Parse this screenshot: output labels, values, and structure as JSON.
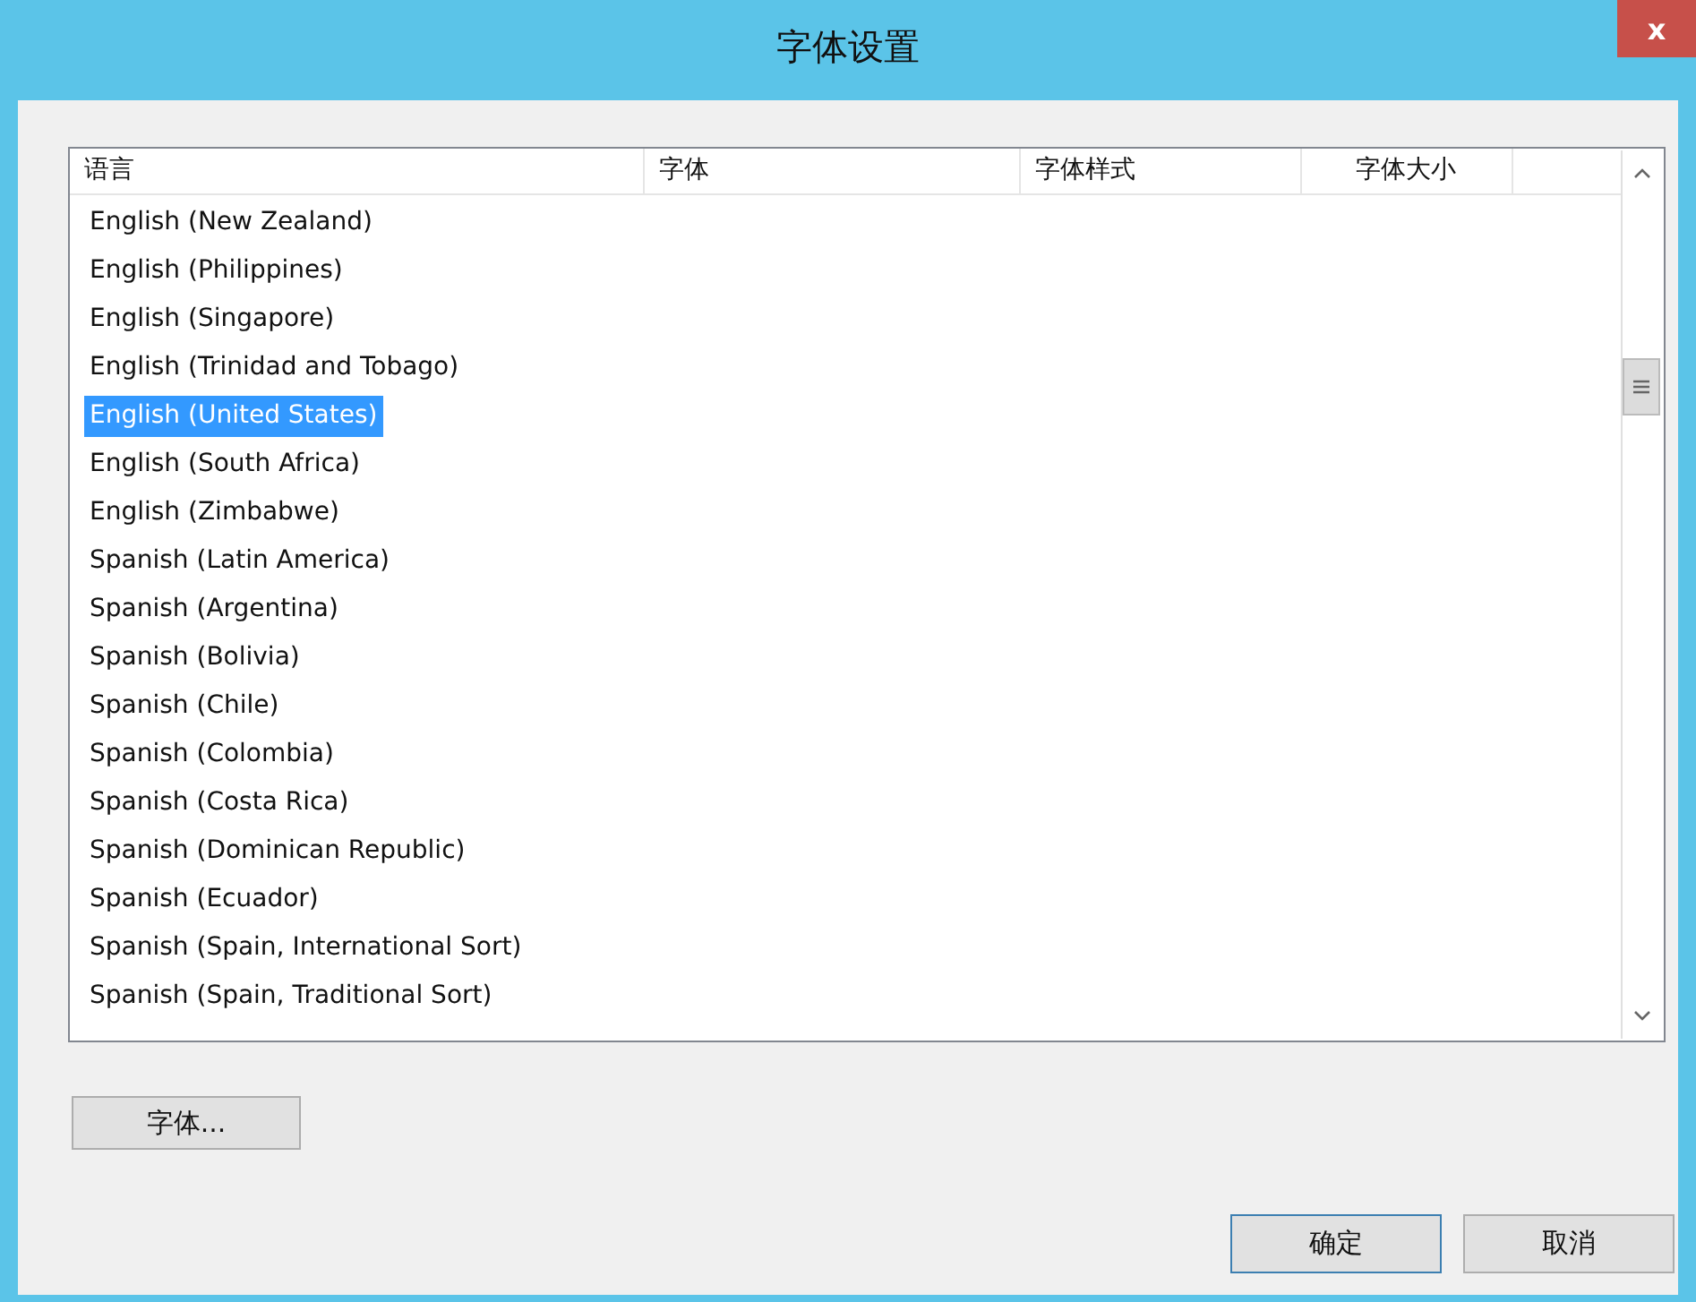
{
  "window": {
    "title": "字体设置",
    "close": "x"
  },
  "table": {
    "columns": [
      "语言",
      "字体",
      "字体样式",
      "字体大小"
    ],
    "rows": [
      {
        "language": "English (New Zealand)",
        "selected": false
      },
      {
        "language": "English (Philippines)",
        "selected": false
      },
      {
        "language": "English (Singapore)",
        "selected": false
      },
      {
        "language": "English (Trinidad and Tobago)",
        "selected": false
      },
      {
        "language": "English (United States)",
        "selected": true
      },
      {
        "language": "English (South Africa)",
        "selected": false
      },
      {
        "language": "English (Zimbabwe)",
        "selected": false
      },
      {
        "language": "Spanish (Latin America)",
        "selected": false
      },
      {
        "language": "Spanish (Argentina)",
        "selected": false
      },
      {
        "language": "Spanish (Bolivia)",
        "selected": false
      },
      {
        "language": "Spanish (Chile)",
        "selected": false
      },
      {
        "language": "Spanish (Colombia)",
        "selected": false
      },
      {
        "language": "Spanish (Costa Rica)",
        "selected": false
      },
      {
        "language": "Spanish (Dominican Republic)",
        "selected": false
      },
      {
        "language": "Spanish (Ecuador)",
        "selected": false
      },
      {
        "language": "Spanish (Spain, International Sort)",
        "selected": false
      },
      {
        "language": "Spanish (Spain, Traditional Sort)",
        "selected": false
      }
    ]
  },
  "font_button": "字体...",
  "buttons": [
    {
      "label": "确定",
      "kind": "default"
    },
    {
      "label": "取消",
      "kind": "normal"
    }
  ]
}
